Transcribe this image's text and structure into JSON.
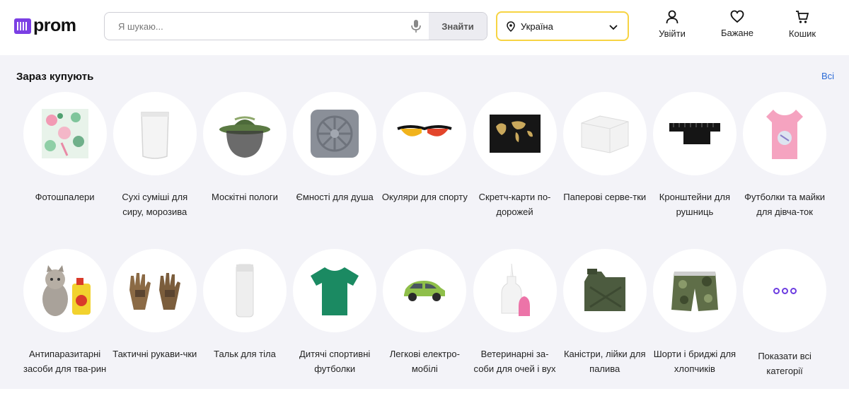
{
  "header": {
    "logo_text": "prom",
    "search_placeholder": "Я шукаю...",
    "search_button": "Знайти",
    "region": "Україна",
    "login": "Увійти",
    "wishlist": "Бажане",
    "cart": "Кошик"
  },
  "section": {
    "title": "Зараз купують",
    "all_link": "Всі"
  },
  "categories": [
    {
      "label": "Фотошпалери",
      "icon": "wallpaper-image"
    },
    {
      "label": "Сухі суміші для сиру, морозива",
      "icon": "pouch-image"
    },
    {
      "label": "Москітні пологи",
      "icon": "mosquito-hat-image"
    },
    {
      "label": "Ємності для душа",
      "icon": "shower-tank-image"
    },
    {
      "label": "Окуляри для спорту",
      "icon": "sport-glasses-image"
    },
    {
      "label": "Скретч-карти по-дорожей",
      "icon": "scratch-map-image"
    },
    {
      "label": "Паперові серве-тки",
      "icon": "napkins-image"
    },
    {
      "label": "Кронштейни для рушниць",
      "icon": "rifle-mount-image"
    },
    {
      "label": "Футболки та майки для дівча-ток",
      "icon": "girls-tshirt-image"
    },
    {
      "label": "Антипаразитарні засоби для тва-рин",
      "icon": "cat-spray-image"
    },
    {
      "label": "Тактичні рукави-чки",
      "icon": "tactical-gloves-image"
    },
    {
      "label": "Тальк для тіла",
      "icon": "talc-bottle-image"
    },
    {
      "label": "Дитячі спортивні футболки",
      "icon": "green-tshirt-image"
    },
    {
      "label": "Легкові електро-мобілі",
      "icon": "electric-car-image"
    },
    {
      "label": "Ветеринарні за-соби для очей і вух",
      "icon": "vet-drops-image"
    },
    {
      "label": "Каністри, лійки для палива",
      "icon": "jerrycan-image"
    },
    {
      "label": "Шорти і бриджі для хлопчиків",
      "icon": "camo-shorts-image"
    },
    {
      "label": "Показати всі категорії",
      "icon": "more-dots-icon"
    }
  ],
  "colors": {
    "brand": "#7b3fe4",
    "region_border": "#f7d443",
    "link": "#2c6bd6",
    "section_bg": "#f3f3f8"
  }
}
